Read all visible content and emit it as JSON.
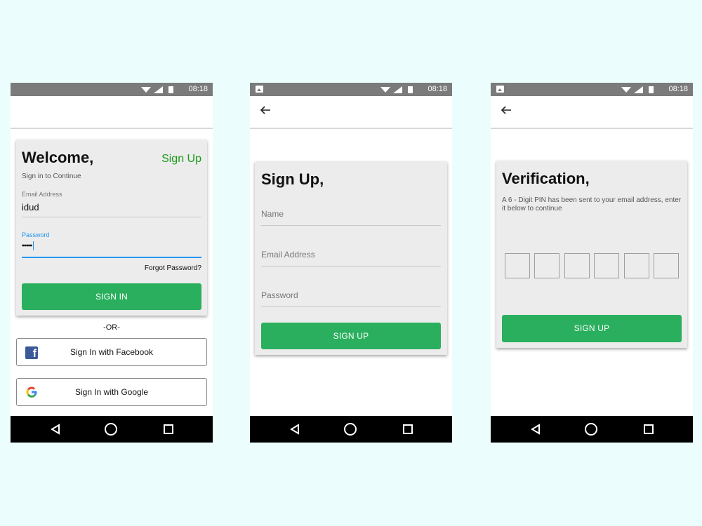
{
  "status": {
    "time": "08:18"
  },
  "screen1": {
    "title": "Welcome,",
    "signup_link": "Sign Up",
    "subtitle": "Sign in to Continue",
    "email_label": "Email Address",
    "email_value": "idud",
    "password_label": "Password",
    "password_value": "•••••",
    "forgot": "Forgot Password?",
    "signin_button": "SIGN IN",
    "or_text": "-OR-",
    "facebook_button": "Sign In with Facebook",
    "google_button": "Sign In with Google"
  },
  "screen2": {
    "title": "Sign Up,",
    "name_placeholder": "Name",
    "email_placeholder": "Email Address",
    "password_placeholder": "Password",
    "signup_button": "SIGN UP"
  },
  "screen3": {
    "title": "Verification,",
    "description": "A 6 - Digit PIN has been sent to your email address, enter it below to continue",
    "signup_button": "SIGN UP",
    "pin_count": 6
  },
  "colors": {
    "background": "#ecfdfd",
    "status_bar": "#7b7b7b",
    "accent_green": "#2aaf5e",
    "link_green": "#1a9a1a",
    "focus_blue": "#2196f3",
    "facebook_blue": "#3b5998"
  },
  "icons": [
    "wifi-icon",
    "signal-icon",
    "battery-icon",
    "back-arrow-icon",
    "nav-back-icon",
    "nav-home-icon",
    "nav-recent-icon",
    "facebook-icon",
    "google-icon",
    "gallery-icon"
  ]
}
